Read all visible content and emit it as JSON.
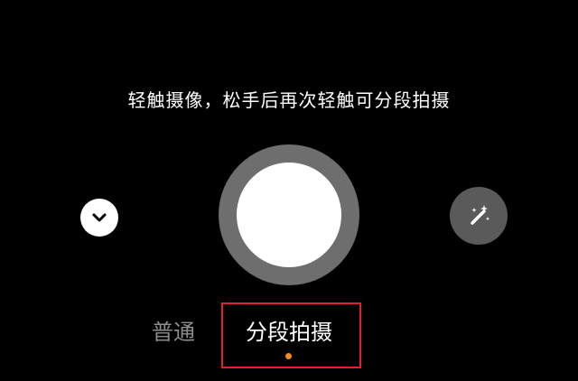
{
  "hint": {
    "text": "轻触摄像，松手后再次轻触可分段拍摄"
  },
  "controls": {
    "collapse_icon": "chevron-down-icon",
    "effects_icon": "magic-wand-icon"
  },
  "modes": {
    "items": [
      {
        "label": "普通",
        "selected": false
      },
      {
        "label": "分段拍摄",
        "selected": true
      }
    ]
  },
  "colors": {
    "background": "#000000",
    "shutter_ring": "#6e6e6e",
    "shutter_core": "#ffffff",
    "inactive_mode": "#8d8d8d",
    "active_mode": "#ffffff",
    "selection_dot": "#f08a24",
    "highlight_box": "#e3202a"
  }
}
